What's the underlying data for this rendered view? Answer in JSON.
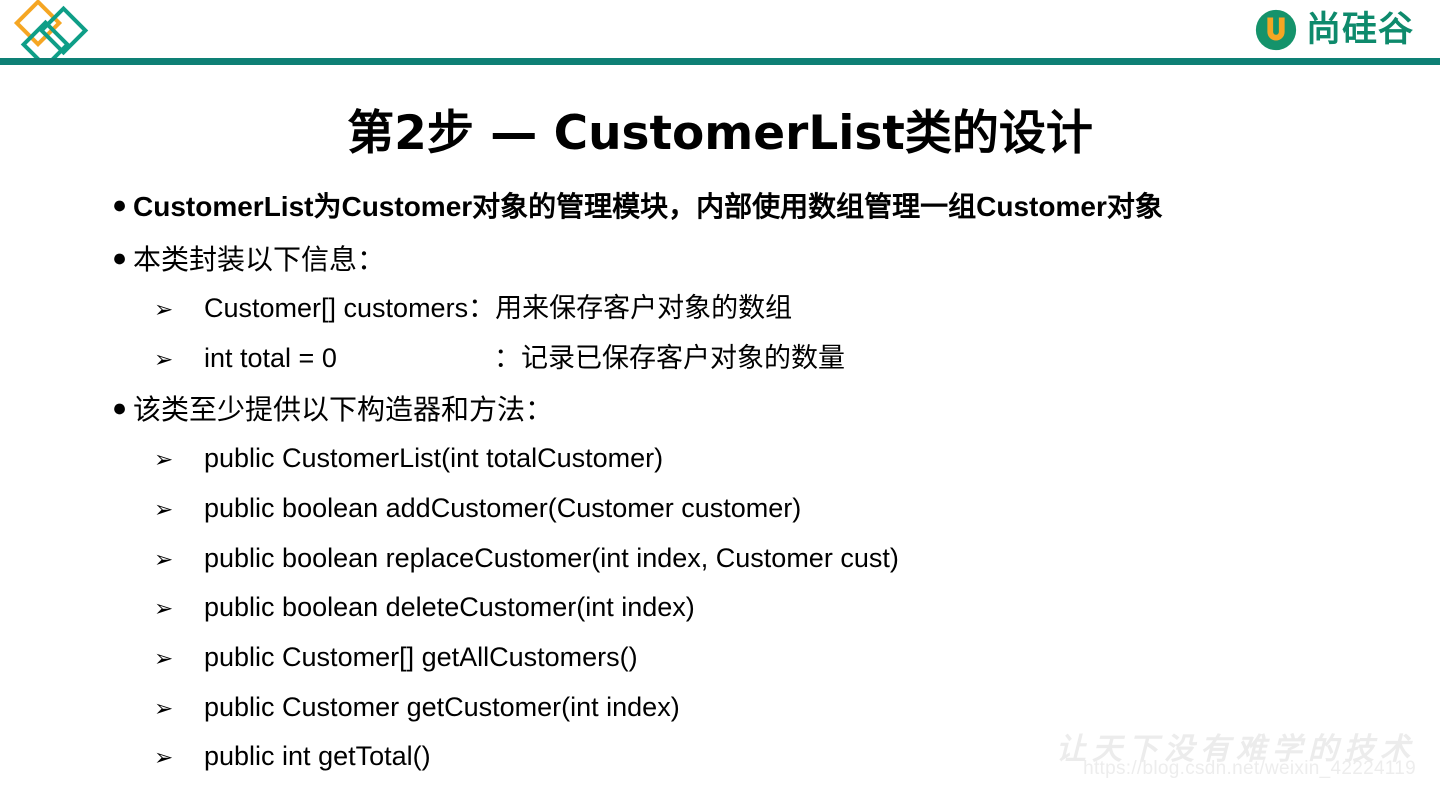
{
  "header": {
    "brand_text": "尚硅谷",
    "brand_color": "#0E8A6C",
    "rule_color": "#0E8075",
    "diamond_colors": {
      "orange": "#F5A623",
      "teal": "#0E9E87"
    },
    "logo_icon": "u-circle-logo-icon",
    "decor_icon": "three-diamonds-icon"
  },
  "title": "第2步 — CustomerList类的设计",
  "content": {
    "bullet1": {
      "marker": "●",
      "text": "CustomerList为Customer对象的管理模块，内部使用数组管理一组Customer对象"
    },
    "bullet2": {
      "marker": "●",
      "text": "本类封装以下信息："
    },
    "fields": [
      {
        "marker": "➢",
        "name": "Customer[] customers：",
        "desc": "用来保存客户对象的数组"
      },
      {
        "marker": "➢",
        "name": "int total = 0",
        "sep": "：",
        "desc": "记录已保存客户对象的数量"
      }
    ],
    "bullet3": {
      "marker": "●",
      "text": "该类至少提供以下构造器和方法："
    },
    "methods": [
      {
        "marker": "➢",
        "signature": "public CustomerList(int totalCustomer)"
      },
      {
        "marker": "➢",
        "signature": "public boolean addCustomer(Customer customer)"
      },
      {
        "marker": "➢",
        "signature": "public boolean replaceCustomer(int index, Customer cust)"
      },
      {
        "marker": "➢",
        "signature": "public boolean deleteCustomer(int index)"
      },
      {
        "marker": "➢",
        "signature": "public Customer[] getAllCustomers()"
      },
      {
        "marker": "➢",
        "signature": "public Customer getCustomer(int index)"
      },
      {
        "marker": "➢",
        "signature": "public int getTotal()"
      }
    ]
  },
  "watermark": {
    "slogan": "让天下没有难学的技术",
    "url": "https://blog.csdn.net/weixin_42224119"
  }
}
